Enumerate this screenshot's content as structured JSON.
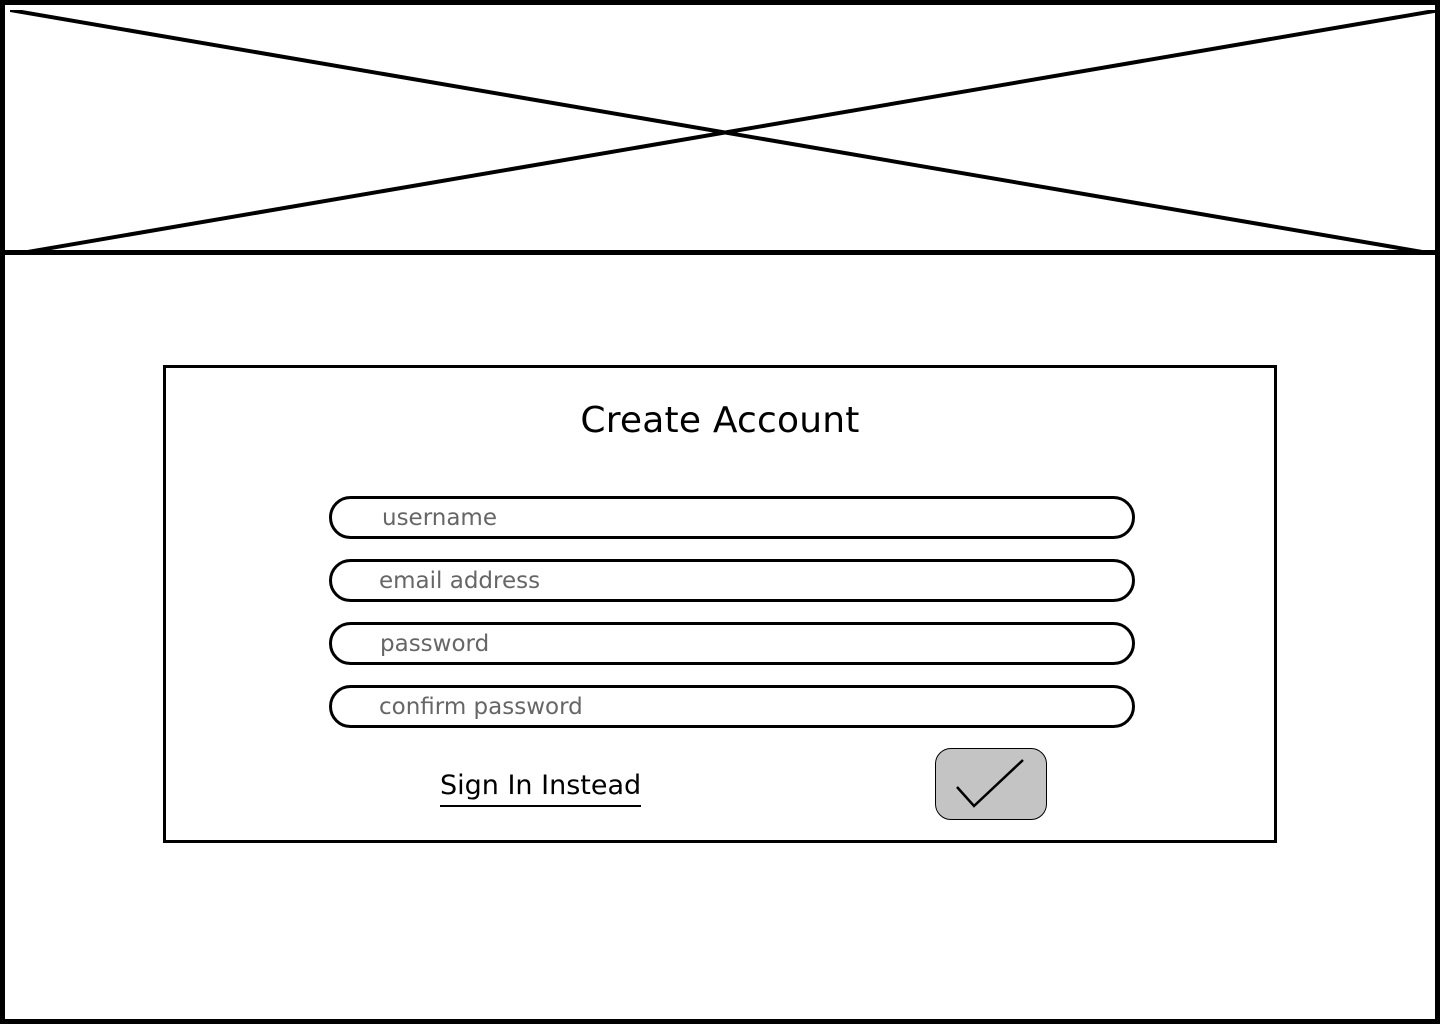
{
  "hero": {
    "icon": "image-placeholder-icon"
  },
  "form": {
    "title": "Create Account",
    "fields": {
      "username": {
        "placeholder": "username",
        "value": ""
      },
      "email": {
        "placeholder": "email address",
        "value": ""
      },
      "password": {
        "placeholder": "password",
        "value": ""
      },
      "confirm_password": {
        "placeholder": "confirm password",
        "value": ""
      }
    },
    "sign_in_link": "Sign In Instead",
    "submit_icon": "checkmark-icon"
  },
  "colors": {
    "border": "#000000",
    "background": "#ffffff",
    "placeholder_text": "#666666",
    "submit_fill": "#c4c4c4"
  }
}
